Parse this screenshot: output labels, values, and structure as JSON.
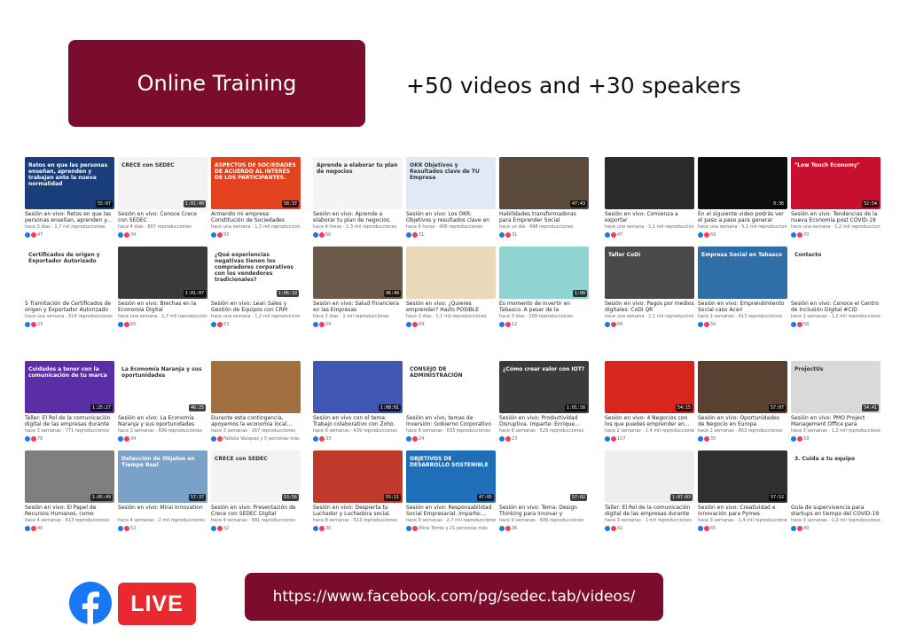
{
  "banner": {
    "title": "Online Training"
  },
  "headline": "+50 videos and +30 speakers",
  "footer": {
    "live_label": "LIVE",
    "url": "https://www.facebook.com/pg/sedec.tab/videos/"
  },
  "groups": [
    {
      "videos": [
        {
          "title": "Sesión en vivo: Retos en que las personas enseñan, aprenden y...",
          "meta": "hace 3 días · 1,7 mil reproducciones",
          "reactions": "47",
          "duration": "55:07",
          "bg": "#1a3e7a",
          "thumb_text": "Retos en que las personas enseñan, aprenden y trabajan ante la nueva normalidad"
        },
        {
          "title": "Sesión en vivo: Conoce Crece con SEDEC",
          "meta": "hace 4 días · 807 reproducciones",
          "reactions": "34",
          "duration": "1:01:40",
          "bg": "#f3f3f3",
          "thumb_text": "CRECE con SEDEC"
        },
        {
          "title": "Armando mi empresa: Constitución de Sociedades",
          "meta": "hace una semana · 1,3 mil reproducciones",
          "reactions": "93",
          "duration": "58:37",
          "bg": "#e2421f",
          "thumb_text": "ASPECTOS DE SOCIEDADES DE ACUERDO AL INTERÉS DE LOS PARTICIPANTES."
        },
        {
          "title": "5 Tramitación de Certificados de origen y Exportador Autorizado",
          "meta": "hace una semana · 514 reproducciones",
          "reactions": "23",
          "duration": "",
          "bg": "#ffffff",
          "thumb_text": "Certificados de origen y Exportador Autorizado"
        },
        {
          "title": "Sesión en vivo: Brechas en la Economía Digital",
          "meta": "hace una semana · 1,7 mil reproducciones",
          "reactions": "65",
          "duration": "1:01:07",
          "bg": "#3a3a3a",
          "thumb_text": ""
        },
        {
          "title": "Sesión en vivo: Lean Sales y Gestión de Equipos con CRM Pipedrive",
          "meta": "hace una semana · 1,2 mil reproducciones",
          "reactions": "53",
          "duration": "1:06:10",
          "bg": "#ffffff",
          "thumb_text": "¿Qué experiencias negativas tienen los compradores corporativos con los vendedores tradicionales?"
        }
      ]
    },
    {
      "videos": [
        {
          "title": "Sesión en vivo: Aprende a elaborar tu plan de negocios.",
          "meta": "hace 4 horas · 1,3 mil reproducciones",
          "reactions": "60",
          "duration": "",
          "bg": "#f4f4f4",
          "thumb_text": "Aprende a elaborar tu plan de negocios"
        },
        {
          "title": "Sesión en vivo: Los OKR: Objetivos y resultados clave en tu Empresa",
          "meta": "hace 6 horas · 406 reproducciones",
          "reactions": "31",
          "duration": "",
          "bg": "#dfeaf6",
          "thumb_text": "OKR Objetivos y Resultados clave de TU Empresa"
        },
        {
          "title": "Habilidades transformadoras para Emprender Social",
          "meta": "hace un día · 498 reproducciones",
          "reactions": "31",
          "duration": "47:43",
          "bg": "#5a4b3a",
          "thumb_text": ""
        },
        {
          "title": "Sesión en vivo: Salud Financiera en las Empresas",
          "meta": "hace 2 días · 1 mil reproducciones",
          "reactions": "29",
          "duration": "46:49",
          "bg": "#6b5a4a",
          "thumb_text": ""
        },
        {
          "title": "Sesión en vivo: ¿Quieres emprender? Hazlo POSIBLE",
          "meta": "hace 3 días · 1,1 mil reproducciones",
          "reactions": "69",
          "duration": "",
          "bg": "#e9d9b8",
          "thumb_text": ""
        },
        {
          "title": "Es momento de invertir en Tabasco. A pesar de la contingencia, nuestr...",
          "meta": "hace 3 días · 399 reproducciones",
          "reactions": "12",
          "duration": "1:00",
          "bg": "#8fd4d0",
          "thumb_text": ""
        }
      ]
    },
    {
      "videos": [
        {
          "title": "Sesión en vivo: Comienza a exportar",
          "meta": "hace una semana · 1,1 mil reproducciones",
          "reactions": "47",
          "duration": "",
          "bg": "#2b2b2b",
          "thumb_text": ""
        },
        {
          "title": "En el siguiente video podrás ver el paso a paso para generar una...",
          "meta": "hace una semana · 5,1 mil reproducciones",
          "reactions": "69",
          "duration": "0:36",
          "bg": "#0e0e0e",
          "thumb_text": ""
        },
        {
          "title": "Sesión en vivo: Tendencias de la nueva Economía post COVID-19",
          "meta": "hace una semana · 1,2 mil reproducciones",
          "reactions": "70",
          "duration": "52:54",
          "bg": "#c8102e",
          "thumb_text": "\"Low Touch Economy\""
        },
        {
          "title": "Sesión en vivo: Pagos por medios digitales: CoDi QR",
          "meta": "hace una semana · 1,1 mil reproducciones",
          "reactions": "66",
          "duration": "",
          "bg": "#4a4a4a",
          "thumb_text": "Taller CoDi"
        },
        {
          "title": "Sesión en vivo: Emprendimiento Social caso Acari",
          "meta": "hace 2 semanas · 913 reproducciones",
          "reactions": "50",
          "duration": "",
          "bg": "#2f6fa8",
          "thumb_text": "Empresa Social en Tabasco"
        },
        {
          "title": "Sesión en vivo: Conoce el Centro de Inclusión Digital #CID",
          "meta": "hace 2 semanas · 1,2 mil reproducciones",
          "reactions": "58",
          "duration": "",
          "bg": "#ffffff",
          "thumb_text": "Contacto"
        }
      ]
    },
    {
      "videos": [
        {
          "title": "Taller: El Rol de la comunicación digital de las empresas durante y...",
          "meta": "hace 3 semanas · 771 reproducciones",
          "reactions": "78",
          "duration": "1:25:27",
          "bg": "#5a2ea6",
          "thumb_text": "Cuidados a tener con la comunicación de tu marca"
        },
        {
          "title": "Sesión en vivo: La Economía Naranja y sus oportunidades",
          "meta": "hace 3 semanas · 699 reproducciones",
          "reactions": "34",
          "duration": "46:25",
          "bg": "#ffffff",
          "thumb_text": "La Economía Naranja y sus oportunidades"
        },
        {
          "title": "Durante esta contingencia, apoyemos la economía local...",
          "meta": "hace 3 semanas · 167 reproducciones",
          "reactions": "Fabiola Vázquez y 5 personas más",
          "duration": "",
          "bg": "#a07040",
          "thumb_text": ""
        },
        {
          "title": "Sesión en vivo: El Papel de Recursos Humanos, como Business Partner...",
          "meta": "hace 4 semanas · 613 reproducciones",
          "reactions": "40",
          "duration": "1:05:49",
          "bg": "#7f7f7f",
          "thumb_text": ""
        },
        {
          "title": "Sesión en vivo: Mirai Innovation",
          "meta": "hace 4 semanas · 2 mil reproducciones",
          "reactions": "52",
          "duration": "57:37",
          "bg": "#7aa1c8",
          "thumb_text": "Detección de Objetos en Tiempo Real"
        },
        {
          "title": "Sesión en vivo: Presentación de Crece con SEDEC Digital",
          "meta": "hace 4 semanas · 991 reproducciones",
          "reactions": "32",
          "duration": "53:56",
          "bg": "#f3f3f3",
          "thumb_text": "CRECE con SEDEC"
        }
      ]
    },
    {
      "videos": [
        {
          "title": "Sesión en vivo con el tema: Trabajo colaborativo con Zoho. Imparte:...",
          "meta": "hace 6 semanas · 439 reproducciones",
          "reactions": "33",
          "duration": "1:08:01",
          "bg": "#3f56b5",
          "thumb_text": ""
        },
        {
          "title": "Sesión en vivo, temas de Inversión: Gobierno Corporativo y ABACO...",
          "meta": "hace 8 semanas · 633 reproducciones",
          "reactions": "24",
          "duration": "",
          "bg": "#ffffff",
          "thumb_text": "CONSEJO DE ADMINISTRACIÓN"
        },
        {
          "title": "Sesión en vivo: Productividad Disruptiva. Imparte: Enrique...",
          "meta": "hace 8 semanas · 529 reproducciones",
          "reactions": "23",
          "duration": "1:01:58",
          "bg": "#3b3b3b",
          "thumb_text": "¿Cómo crear valor con IOT?"
        },
        {
          "title": "Sesión en vivo: Despierta tu Luchador y Luchadora social. Con...",
          "meta": "hace 8 semanas · 513 reproducciones",
          "reactions": "30",
          "duration": "55:11",
          "bg": "#c0392b",
          "thumb_text": ""
        },
        {
          "title": "Sesión en vivo: Responsabilidad Social Empresarial. Imparte:...",
          "meta": "hace 9 semanas · 2,7 mil reproducciones",
          "reactions": "Alina Torres y 21 personas más",
          "duration": "47:05",
          "bg": "#1f6fb8",
          "thumb_text": "OBJETIVOS DE DESARROLLO SOSTENIBLE"
        },
        {
          "title": "Sesión en vivo: Tema: Design Thinking para innovar y emprender...",
          "meta": "hace 9 semanas · 606 reproducciones",
          "reactions": "36",
          "duration": "57:02",
          "bg": "#ffffff",
          "thumb_text": ""
        }
      ]
    },
    {
      "videos": [
        {
          "title": "Sesión en vivo: 4 Negocios con los que puedes emprender en...",
          "meta": "hace 2 semanas · 1,4 mil reproducciones",
          "reactions": "107",
          "duration": "54:15",
          "bg": "#d7261e",
          "thumb_text": ""
        },
        {
          "title": "Sesión en vivo: Oportunidades de Negocio en Europa",
          "meta": "hace 2 semanas · 863 reproducciones",
          "reactions": "35",
          "duration": "57:07",
          "bg": "#5a4030",
          "thumb_text": ""
        },
        {
          "title": "Sesión en vivo: PMO Project Management Office para Empresas",
          "meta": "hace 3 semanas · 1,2 mil reproducciones",
          "reactions": "59",
          "duration": "54:41",
          "bg": "#d9d9d9",
          "thumb_text": "ProjectUs"
        },
        {
          "title": "Taller: El Rol de la comunicación digital de las empresas durante y...",
          "meta": "hace 3 semanas · 1 mil reproducciones",
          "reactions": "42",
          "duration": "1:07:03",
          "bg": "#eeeeee",
          "thumb_text": ""
        },
        {
          "title": "Sesión en vivo: Creatividad e innovación para Pymes",
          "meta": "hace 3 semanas · 1,4 mil reproducciones",
          "reactions": "65",
          "duration": "57:52",
          "bg": "#2f2f2f",
          "thumb_text": ""
        },
        {
          "title": "Guía de supervivencia para startups en tiempo del COVID-19",
          "meta": "hace 3 semanas · 1,2 mil reproducciones",
          "reactions": "49",
          "duration": "",
          "bg": "#ffffff",
          "thumb_text": "3. Cuida a tu equipo"
        }
      ]
    }
  ],
  "colors": {
    "brand": "#7a0c2e",
    "facebook": "#1877f2",
    "live": "#e8292f"
  }
}
